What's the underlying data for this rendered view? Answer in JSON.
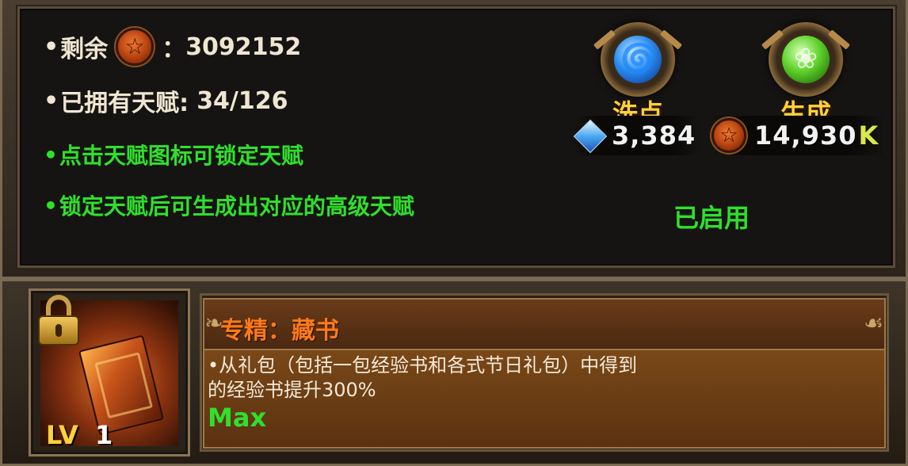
{
  "info": {
    "bullet": "•",
    "remaining_label": "剩余",
    "remaining_sep": "：",
    "remaining_value": "3092152",
    "owned_label": "已拥有天赋:",
    "owned_value": "34/126",
    "tip_lock": "点击天赋图标可锁定天赋",
    "tip_generate": "锁定天赋后可生成出对应的高级天赋"
  },
  "actions": {
    "reset_label": "洗点",
    "reset_cost": "3,384",
    "generate_label": "生成",
    "generate_cost": "14,930",
    "generate_cost_unit": "K",
    "status": "已启用"
  },
  "talent": {
    "title": "专精：藏书",
    "description": "•从礼包（包括一包经验书和各式节日礼包）中得到的经验书提升300%",
    "max_label": "Max",
    "level_label": "LV",
    "level_value": "1"
  },
  "colors": {
    "green_text": "#2fe02c",
    "gold_text": "#ffd13a",
    "orange_title": "#ff7a1a"
  },
  "icons": {
    "currency": "pentagram-coin-icon",
    "gem": "blue-diamond-icon",
    "reset": "blue-swirl-orb-icon",
    "generate": "green-flower-orb-icon",
    "lock": "padlock-icon",
    "talent": "book-bag-icon"
  }
}
